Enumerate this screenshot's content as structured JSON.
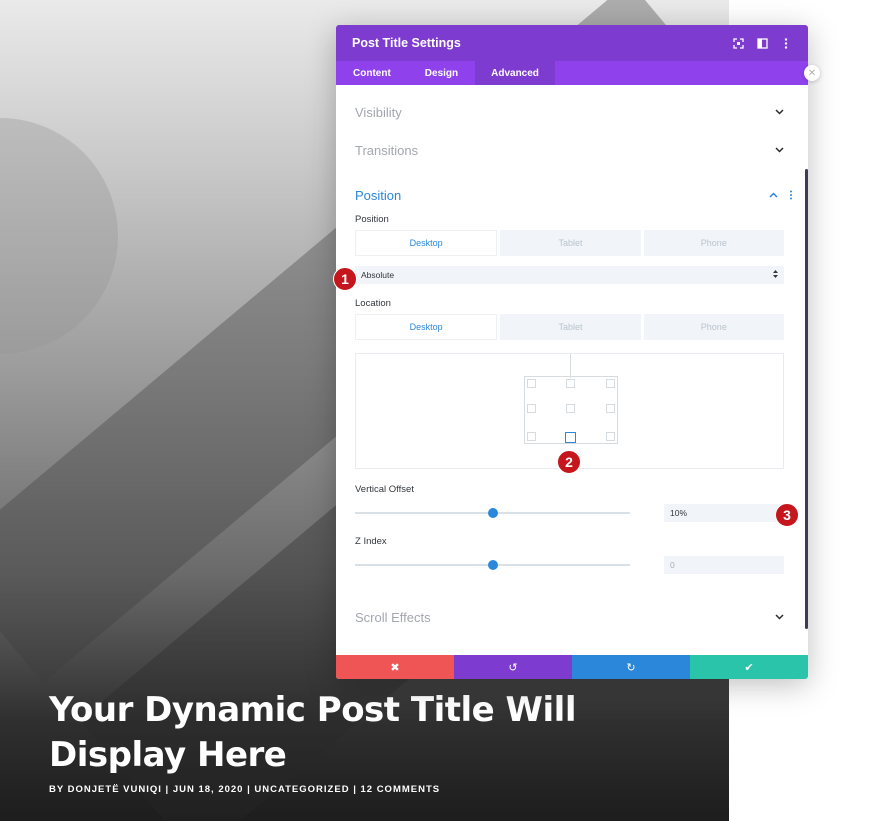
{
  "hero": {
    "title": "Your Dynamic Post Title Will Display Here",
    "meta": "BY DONJETË VUNIQI | JUN 18, 2020 | UNCATEGORIZED | 12 COMMENTS"
  },
  "panel": {
    "title": "Post Title Settings",
    "tabs": [
      {
        "label": "Content",
        "active": false
      },
      {
        "label": "Design",
        "active": false
      },
      {
        "label": "Advanced",
        "active": true
      }
    ],
    "sections": {
      "visibility": "Visibility",
      "transitions": "Transitions",
      "position": "Position",
      "scroll_effects": "Scroll Effects"
    },
    "position": {
      "label": "Position",
      "device_tabs": [
        "Desktop",
        "Tablet",
        "Phone"
      ],
      "select_value": "Absolute"
    },
    "location": {
      "label": "Location",
      "device_tabs": [
        "Desktop",
        "Tablet",
        "Phone"
      ],
      "selected_cell": "bottom-center"
    },
    "vertical_offset": {
      "label": "Vertical Offset",
      "value": "10%",
      "slider_fraction": 0.5
    },
    "z_index": {
      "label": "Z Index",
      "value": "0",
      "slider_fraction": 0.5
    },
    "footer": {
      "cancel_icon": "✖",
      "undo_icon": "↺",
      "redo_icon": "↻",
      "save_icon": "✔"
    }
  },
  "badges": [
    "1",
    "2",
    "3"
  ],
  "colors": {
    "header_purple": "#7e3bd0",
    "tab_purple": "#8f42ec",
    "accent_blue": "#2b87da",
    "cancel_red": "#ef5555",
    "save_green": "#29c4a9",
    "badge_red": "#c4161c"
  },
  "icons": {
    "header": [
      "fullscreen-icon",
      "split-view-icon",
      "more-options-icon"
    ],
    "close": "close-icon"
  }
}
